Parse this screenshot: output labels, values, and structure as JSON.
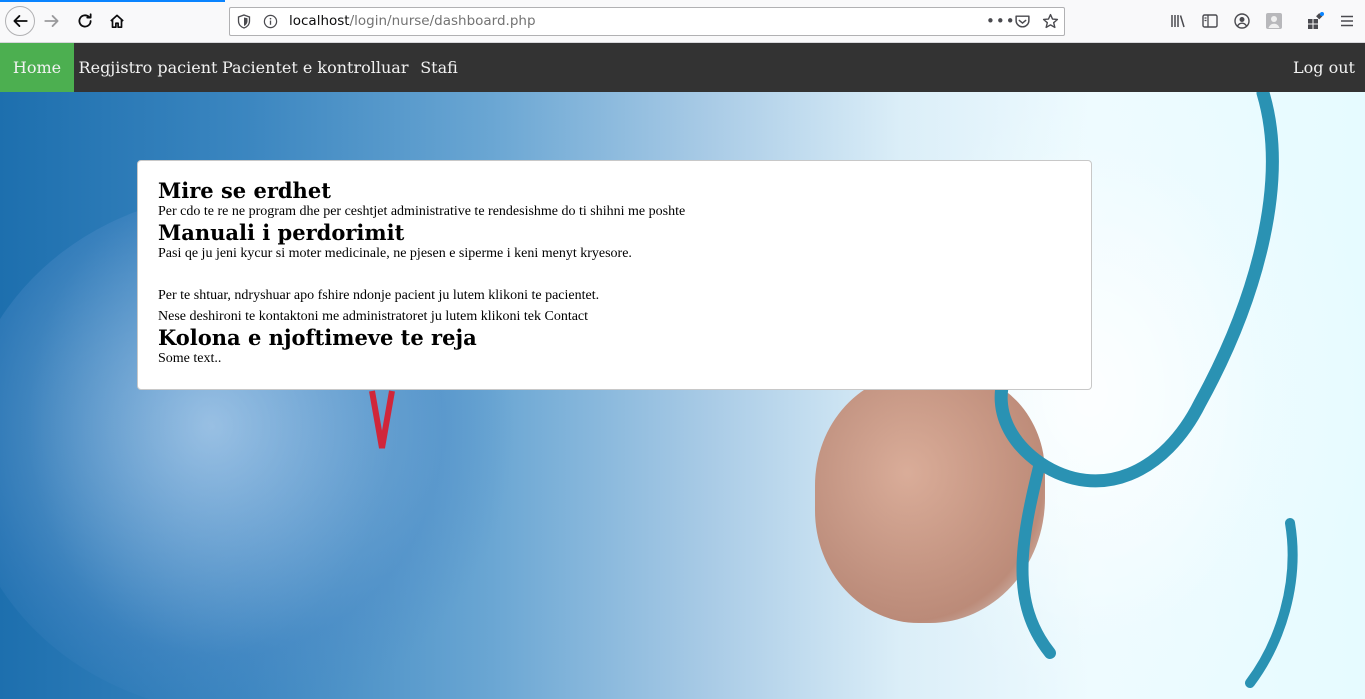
{
  "browser": {
    "url_host": "localhost",
    "url_path": "/login/nurse/dashboard.php",
    "url_actions": "•••"
  },
  "nav": {
    "home": "Home",
    "register_patient": "Regjistro pacient",
    "checked_patients": "Pacientet e kontrolluar",
    "staff": "Stafi",
    "logout": "Log out"
  },
  "colors": {
    "navbar": "#333333",
    "active": "#4caf50"
  },
  "content": {
    "welcome_title": "Mire se erdhet",
    "welcome_text": "Per cdo te re ne program dhe per ceshtjet administrative te rendesishme do ti shihni me poshte",
    "manual_title": "Manuali i perdorimit",
    "manual_text": "Pasi qe ju jeni kycur si moter medicinale, ne pjesen e siperme i keni menyt kryesore.",
    "patients_text": "Per te shtuar, ndryshuar apo fshire ndonje pacient ju lutem klikoni te pacientet.",
    "contact_text": "Nese deshironi te kontaktoni me administratoret ju lutem klikoni tek Contact",
    "news_title": "Kolona e njoftimeve te reja",
    "news_text": "Some text.."
  }
}
